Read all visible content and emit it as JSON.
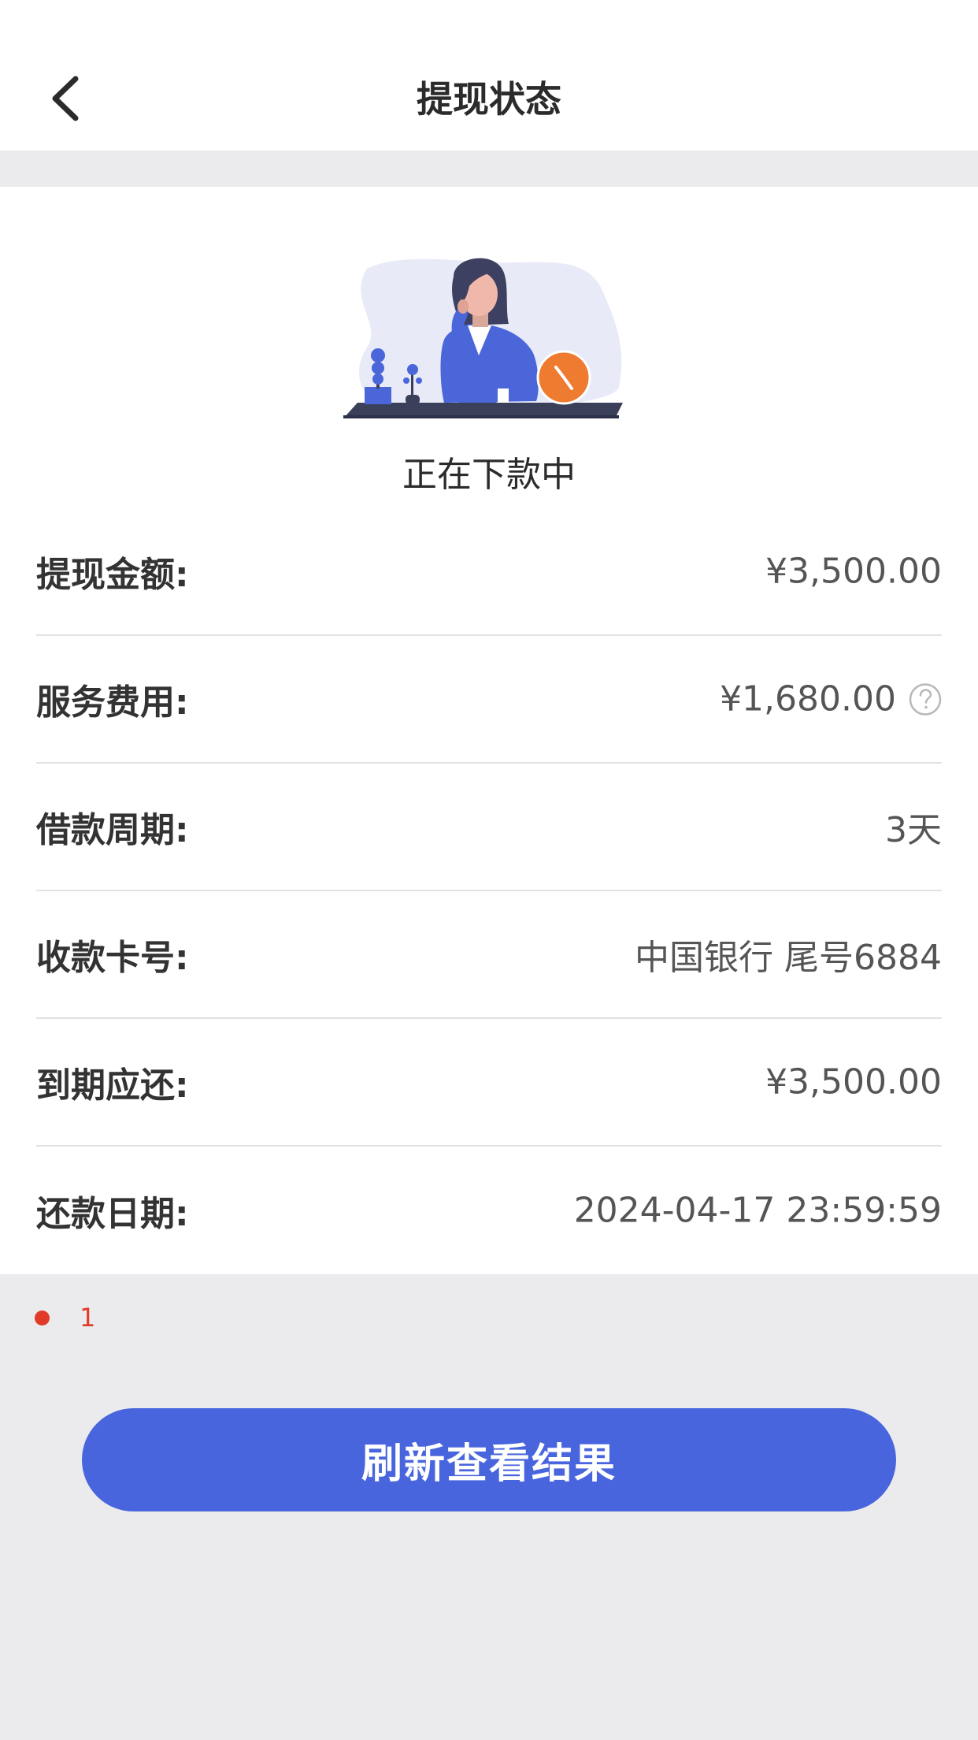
{
  "nav": {
    "title": "提现状态",
    "back_icon": "chevron-left-icon"
  },
  "status": {
    "illustration": "waiting-woman-clock-illustration",
    "text": "正在下款中"
  },
  "rows": [
    {
      "label": "提现金额:",
      "value": "¥3,500.00"
    },
    {
      "label": "服务费用:",
      "value": "¥1,680.00",
      "icon": "question-circle-icon"
    },
    {
      "label": "借款周期:",
      "value": "3天"
    },
    {
      "label": "收款卡号:",
      "value": "中国银行 尾号6884"
    },
    {
      "label": "到期应还:",
      "value": "¥3,500.00"
    },
    {
      "label": "还款日期:",
      "value": "2024-04-17 23:59:59"
    }
  ],
  "note": {
    "text": "1",
    "color": "#e23a2a"
  },
  "button": {
    "label": "刷新查看结果",
    "color": "#4865de"
  }
}
